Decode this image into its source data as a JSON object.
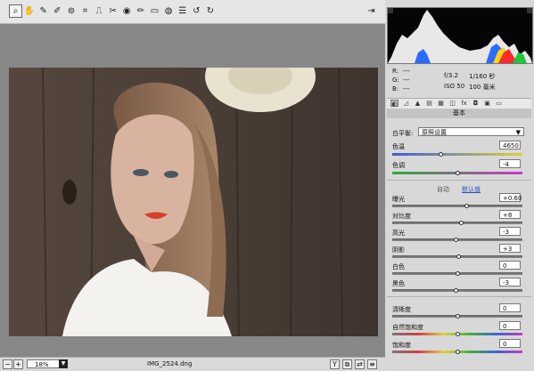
{
  "toolbar": {
    "tools": [
      {
        "name": "zoom-tool-icon",
        "glyph": "⌕",
        "active": true
      },
      {
        "name": "hand-tool-icon",
        "glyph": "✋"
      },
      {
        "name": "white-balance-tool-icon",
        "glyph": "✎"
      },
      {
        "name": "color-sampler-tool-icon",
        "glyph": "✐"
      },
      {
        "name": "targeted-adjustment-tool-icon",
        "glyph": "⊚"
      },
      {
        "name": "crop-tool-icon",
        "glyph": "⌗"
      },
      {
        "name": "straighten-tool-icon",
        "glyph": "⎍"
      },
      {
        "name": "spot-removal-tool-icon",
        "glyph": "✂"
      },
      {
        "name": "red-eye-tool-icon",
        "glyph": "◉"
      },
      {
        "name": "adjustment-brush-icon",
        "glyph": "✏"
      },
      {
        "name": "graduated-filter-icon",
        "glyph": "▭"
      },
      {
        "name": "radial-filter-icon",
        "glyph": "◍"
      },
      {
        "name": "preferences-icon",
        "glyph": "☰"
      },
      {
        "name": "rotate-ccw-icon",
        "glyph": "↺"
      },
      {
        "name": "rotate-cw-icon",
        "glyph": "↻"
      }
    ],
    "fullscreen_glyph": "⇥"
  },
  "histogram_info": {
    "r_label": "R:",
    "r_value": "---",
    "g_label": "G:",
    "g_value": "---",
    "b_label": "B:",
    "b_value": "---",
    "aperture": "f/3.2",
    "shutter": "1/160 秒",
    "iso": "ISO 50",
    "focal": "100 毫米"
  },
  "tabs": [
    "◐",
    "◿",
    "▲",
    "▤",
    "▦",
    "◫",
    "fx",
    "◘",
    "▣",
    "▭"
  ],
  "panel": {
    "title": "基本",
    "wb_label": "白平衡:",
    "wb_value": "原照设置",
    "temp_label": "色温",
    "temp_value": "4650",
    "tint_label": "色调",
    "tint_value": "-4",
    "auto_link": "自动",
    "default_link": "默认值",
    "sliders": [
      {
        "label": "曝光",
        "value": "+0.60",
        "pos": 0.57
      },
      {
        "label": "对比度",
        "value": "+8",
        "pos": 0.53
      },
      {
        "label": "高光",
        "value": "-3",
        "pos": 0.49
      },
      {
        "label": "阴影",
        "value": "+3",
        "pos": 0.51
      },
      {
        "label": "白色",
        "value": "0",
        "pos": 0.5
      },
      {
        "label": "黑色",
        "value": "-3",
        "pos": 0.49
      }
    ],
    "presence": [
      {
        "label": "清晰度",
        "value": "0",
        "pos": 0.5
      },
      {
        "label": "自然饱和度",
        "value": "0",
        "pos": 0.5
      },
      {
        "label": "饱和度",
        "value": "0",
        "pos": 0.5
      }
    ]
  },
  "status": {
    "zoom": "18%",
    "filename": "IMG_2524.dng"
  },
  "colors": {
    "canvas": "#878787",
    "panel": "#d8d8d8",
    "link": "#2a4fc0"
  }
}
